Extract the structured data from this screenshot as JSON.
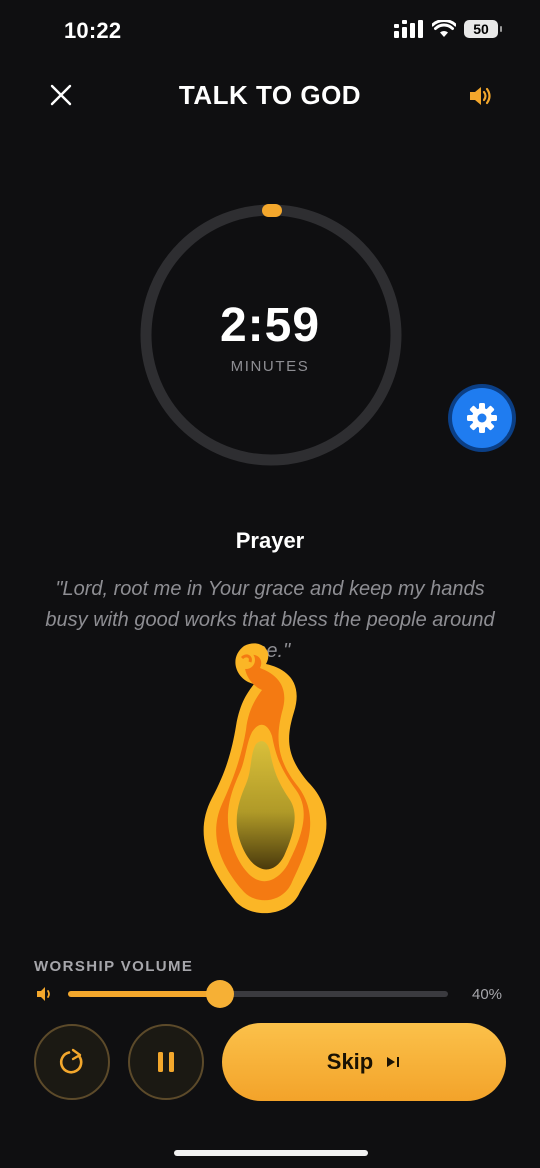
{
  "status_bar": {
    "time": "10:22",
    "battery": "50"
  },
  "header": {
    "title": "TALK TO GOD"
  },
  "timer": {
    "value": "2:59",
    "unit": "MINUTES",
    "progress": 0.0
  },
  "prayer": {
    "title": "Prayer",
    "text": "\"Lord, root me in Your grace and keep my hands busy with good works that bless the people around me.\""
  },
  "volume": {
    "label": "WORSHIP VOLUME",
    "percent_text": "40%",
    "level": 0.4
  },
  "controls": {
    "skip_label": "Skip"
  },
  "colors": {
    "accent": "#f3a72c",
    "settings_blue": "#1f7cf0",
    "background": "#0f0f11"
  }
}
